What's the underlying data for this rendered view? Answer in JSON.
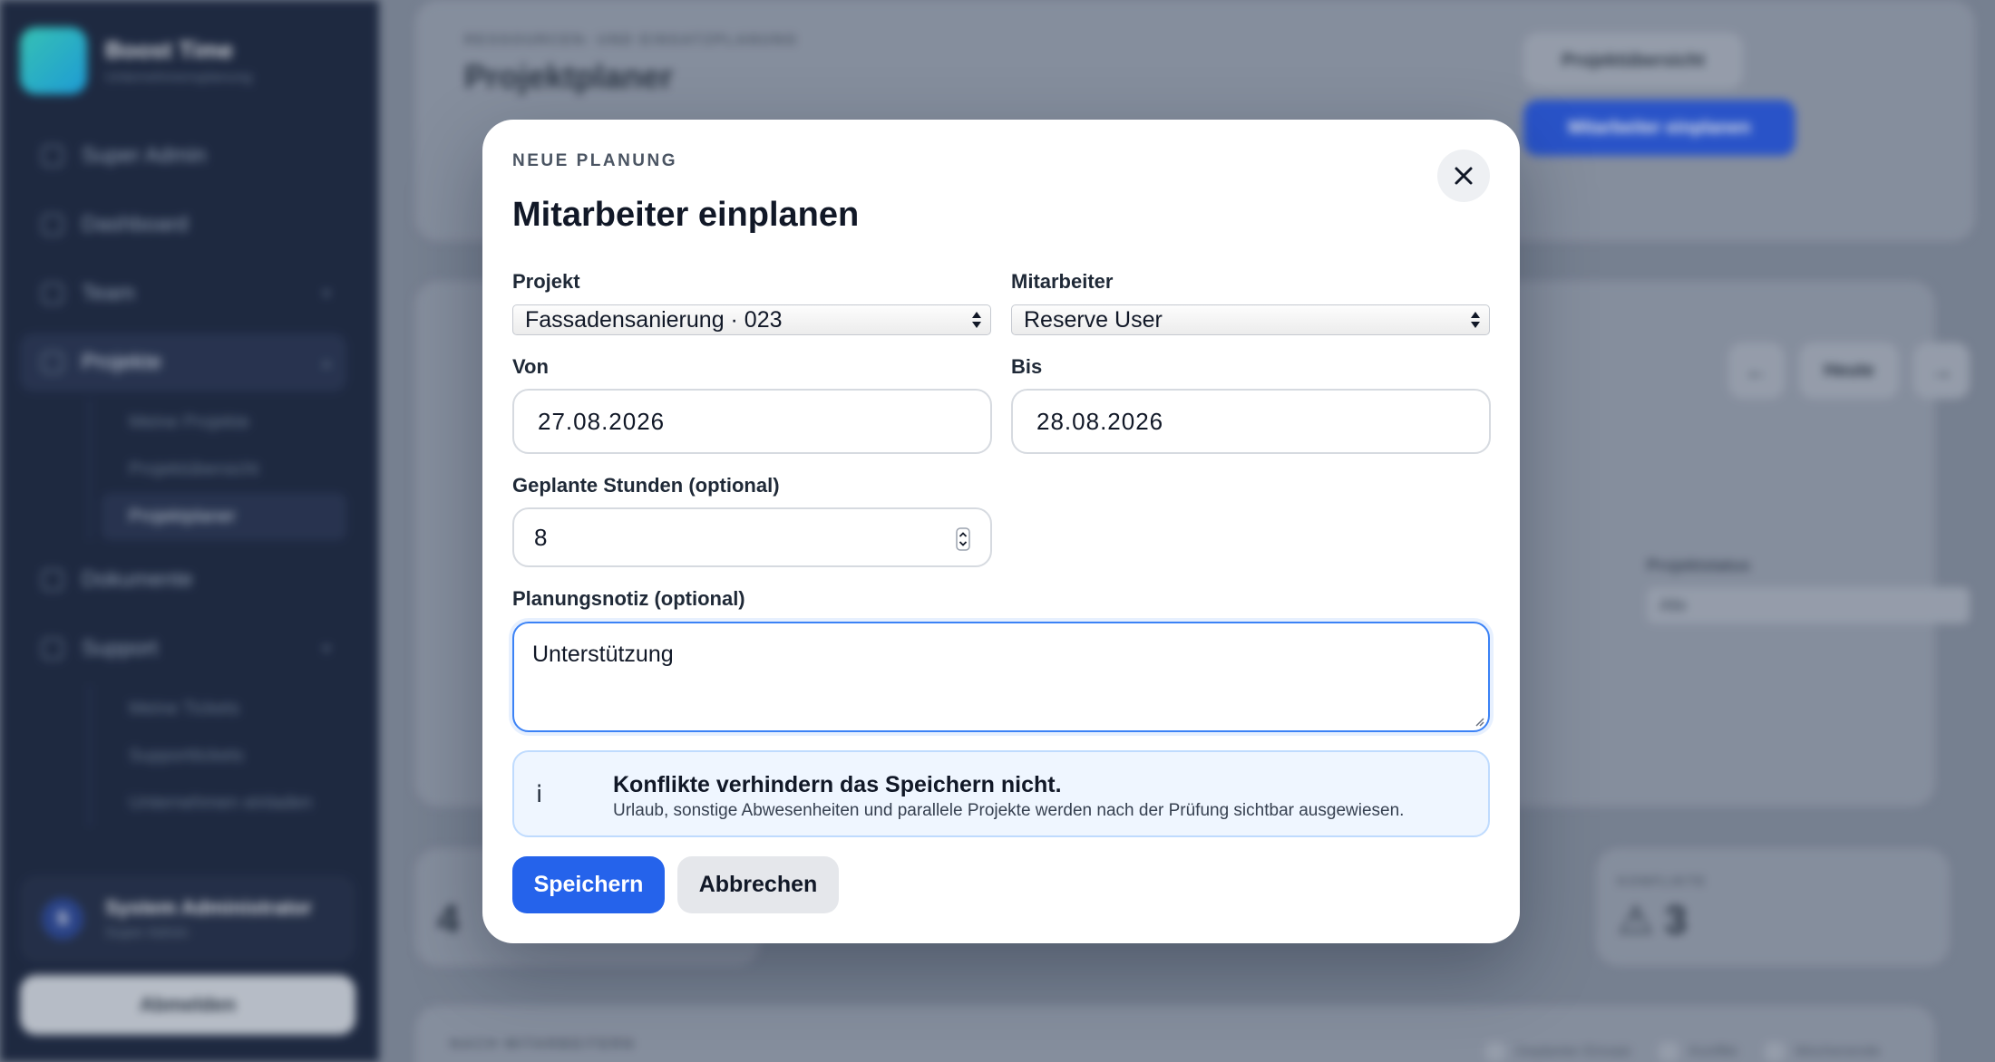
{
  "app": {
    "brand_name": "Boost Time",
    "brand_sub": "Unternehmensplanung",
    "nav": {
      "super_admin": "Super Admin",
      "dashboard": "Dashboard",
      "team": "Team",
      "projects": "Projekte",
      "projects_sub": [
        "Meine Projekte",
        "Projektübersicht",
        "Projektplaner"
      ],
      "documents": "Dokumente",
      "support": "Support",
      "support_sub": [
        "Meine Tickets",
        "Supporttickets",
        "Unternehmen einladen"
      ]
    },
    "user": {
      "initial": "S",
      "name": "System Administrator",
      "role": "Super Admin"
    },
    "logout": "Abmelden"
  },
  "page": {
    "eyebrow": "RESSOURCEN- UND EINSATZPLANUNG",
    "title": "Projektplaner",
    "overview_button": "Projektübersicht",
    "plan_button": "Mitarbeiter einplanen",
    "today_button": "Heute",
    "project_status_label": "Projektstatus",
    "project_status_value": "Alle",
    "stat_left_value": "4",
    "stat_conflicts_label": "KONFLIKTE",
    "stat_conflicts_value": "3",
    "bottom_label": "NACH MITARBEITERN",
    "legend": [
      "Geplanter Einsatz",
      "Konflikt",
      "Wochenende"
    ]
  },
  "modal": {
    "eyebrow": "NEUE PLANUNG",
    "title": "Mitarbeiter einplanen",
    "project_label": "Projekt",
    "project_value": "Fassadensanierung · 023",
    "employee_label": "Mitarbeiter",
    "employee_value": "Reserve User",
    "from_label": "Von",
    "from_value": "27.08.2026",
    "to_label": "Bis",
    "to_value": "28.08.2026",
    "hours_label": "Geplante Stunden (optional)",
    "hours_value": "8",
    "note_label": "Planungsnotiz (optional)",
    "note_value": "Unterstützung",
    "info_icon": "i",
    "info_title": "Konflikte verhindern das Speichern nicht.",
    "info_text": "Urlaub, sonstige Abwesenheiten und parallele Projekte werden nach der Prüfung sichtbar ausgewiesen.",
    "save_label": "Speichern",
    "cancel_label": "Abbrechen"
  }
}
